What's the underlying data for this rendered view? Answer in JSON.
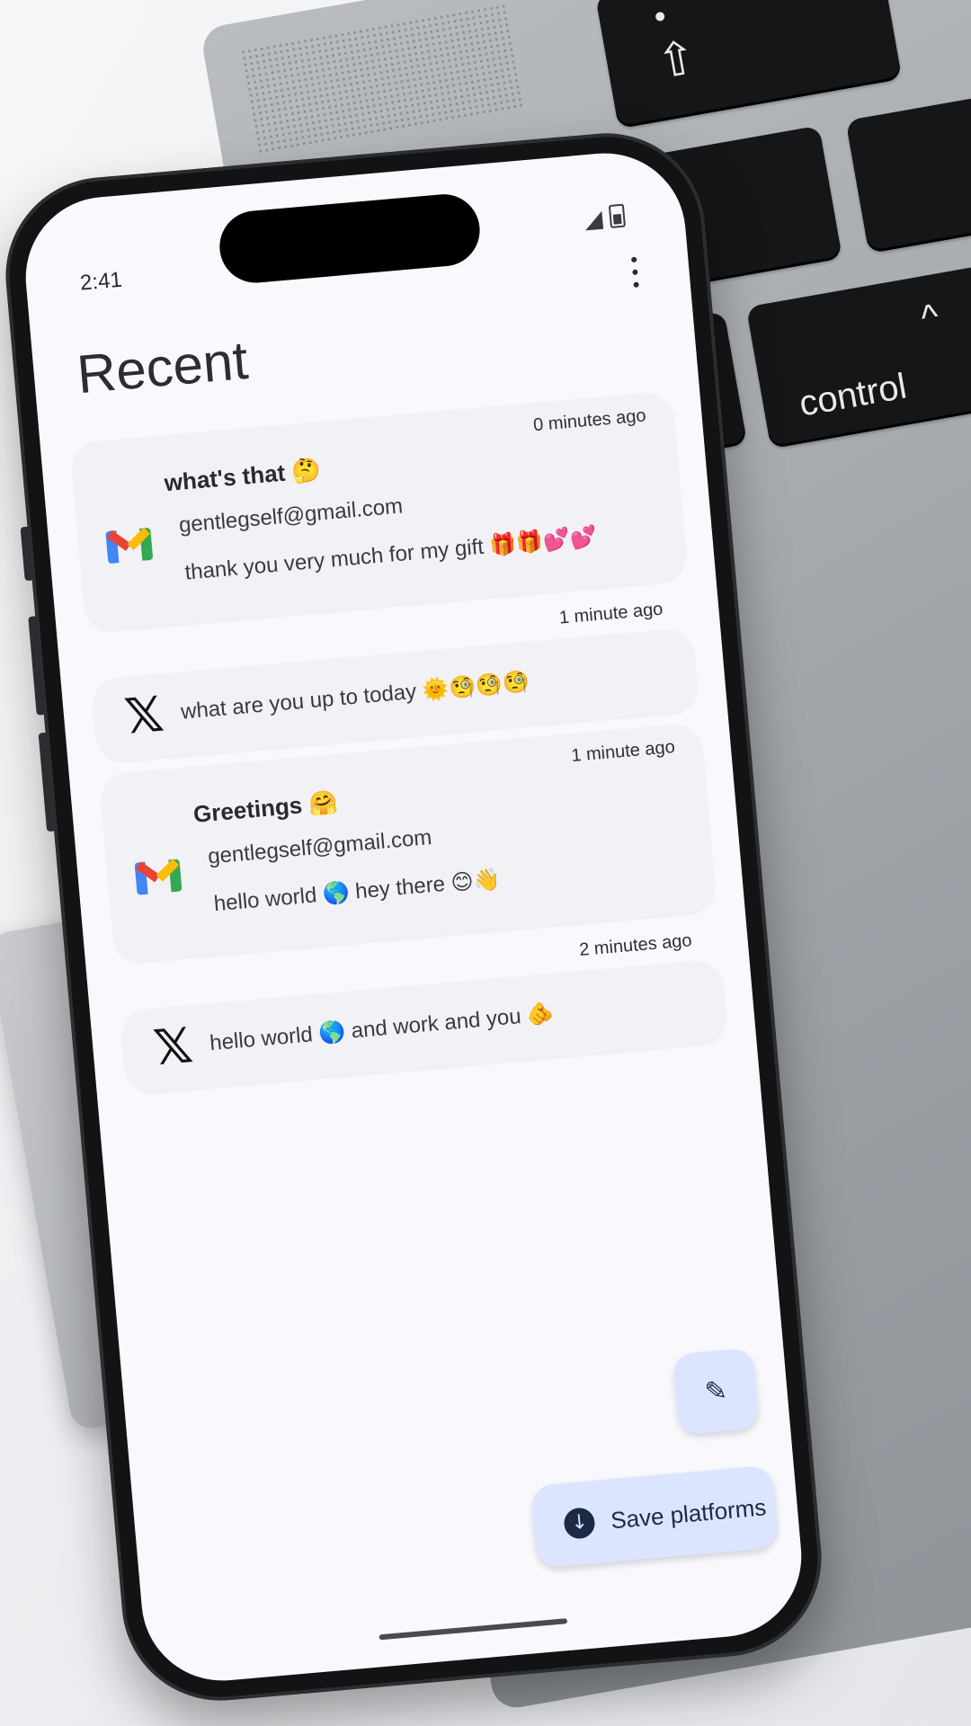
{
  "status_bar": {
    "time": "2:41"
  },
  "header": {
    "title": "Recent"
  },
  "icons": {
    "more": "more-vert-icon",
    "gmail": "gmail-icon",
    "x": "x-icon",
    "edit": "pencil-icon",
    "download": "download-icon"
  },
  "items": [
    {
      "platform": "gmail",
      "time": "0 minutes ago",
      "subject": "what's that 🤔",
      "sender": "gentlegself@gmail.com",
      "body": "thank you very much for my gift 🎁🎁💕💕"
    },
    {
      "platform": "x",
      "time": "1 minute ago",
      "body": "what are you up to today 🌞🧐🧐🧐"
    },
    {
      "platform": "gmail",
      "time": "1 minute ago",
      "subject": "Greetings 🤗",
      "sender": "gentlegself@gmail.com",
      "body": "hello world 🌎 hey there 😊👋"
    },
    {
      "platform": "x",
      "time": "2 minutes ago",
      "body": "hello world 🌎 and work and you 🫵"
    }
  ],
  "actions": {
    "save_label": "Save platforms"
  },
  "backdrop": {
    "key_label": "control"
  },
  "colors": {
    "screen_bg": "#f9f9fd",
    "card_bg": "#f1f1f6",
    "fab_bg": "#dce5ff",
    "fab_fg": "#1c2a45"
  }
}
